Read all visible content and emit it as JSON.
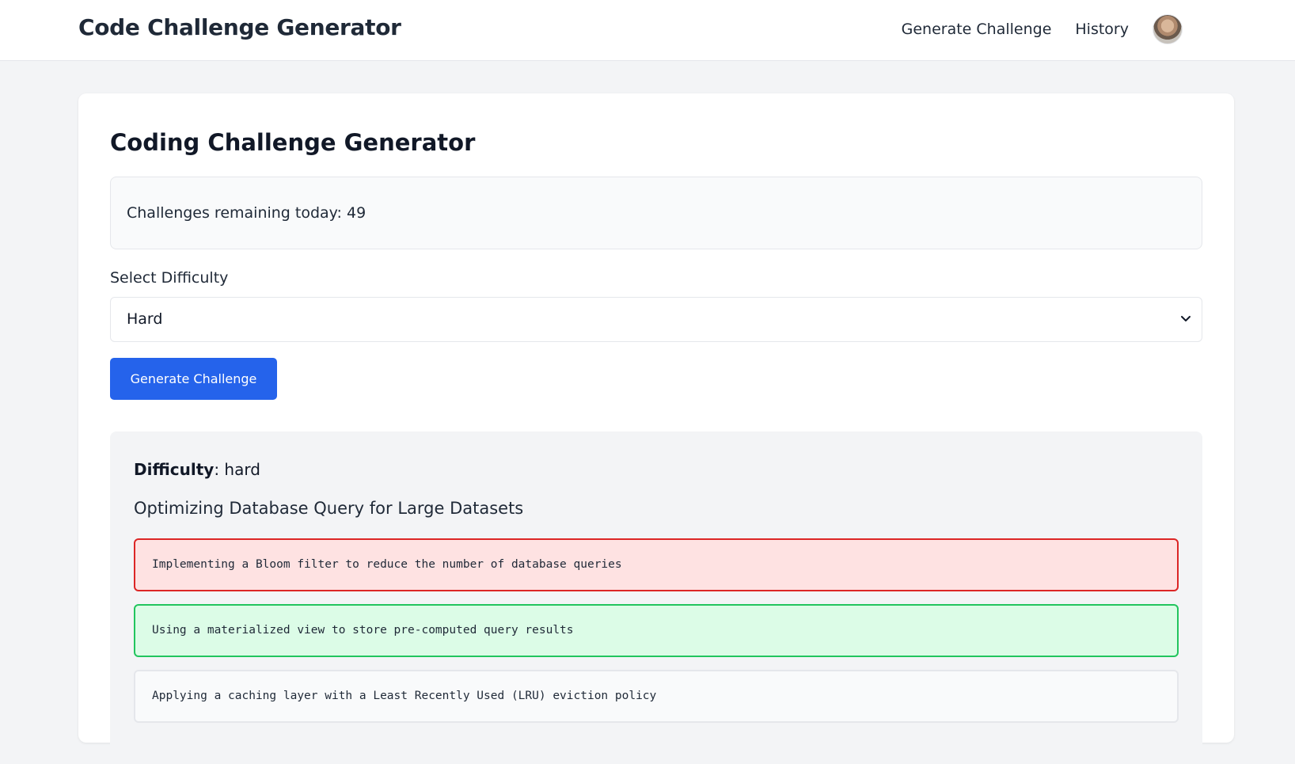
{
  "nav": {
    "brand": "Code Challenge Generator",
    "links": [
      "Generate Challenge",
      "History"
    ]
  },
  "page": {
    "title": "Coding Challenge Generator",
    "quota_text": "Challenges remaining today: 49",
    "select_label": "Select Difficulty",
    "select_value": "Hard",
    "generate_button": "Generate Challenge"
  },
  "challenge": {
    "difficulty_label": "Difficulty",
    "difficulty_value": ": hard",
    "title": "Optimizing Database Query for Large Datasets",
    "options": [
      {
        "text": "Implementing a Bloom filter to reduce the number of database queries",
        "state": "incorrect"
      },
      {
        "text": "Using a materialized view to store pre-computed query results",
        "state": "correct"
      },
      {
        "text": "Applying a caching layer with a Least Recently Used (LRU) eviction policy",
        "state": "neutral"
      }
    ]
  },
  "colors": {
    "primary": "#2563eb",
    "incorrect_bg": "#fee2e2",
    "incorrect_border": "#dc2626",
    "correct_bg": "#dcfce7",
    "correct_border": "#22c55e"
  },
  "icons": {
    "select_chevron": "chevron-down-icon",
    "avatar": "user-avatar"
  }
}
